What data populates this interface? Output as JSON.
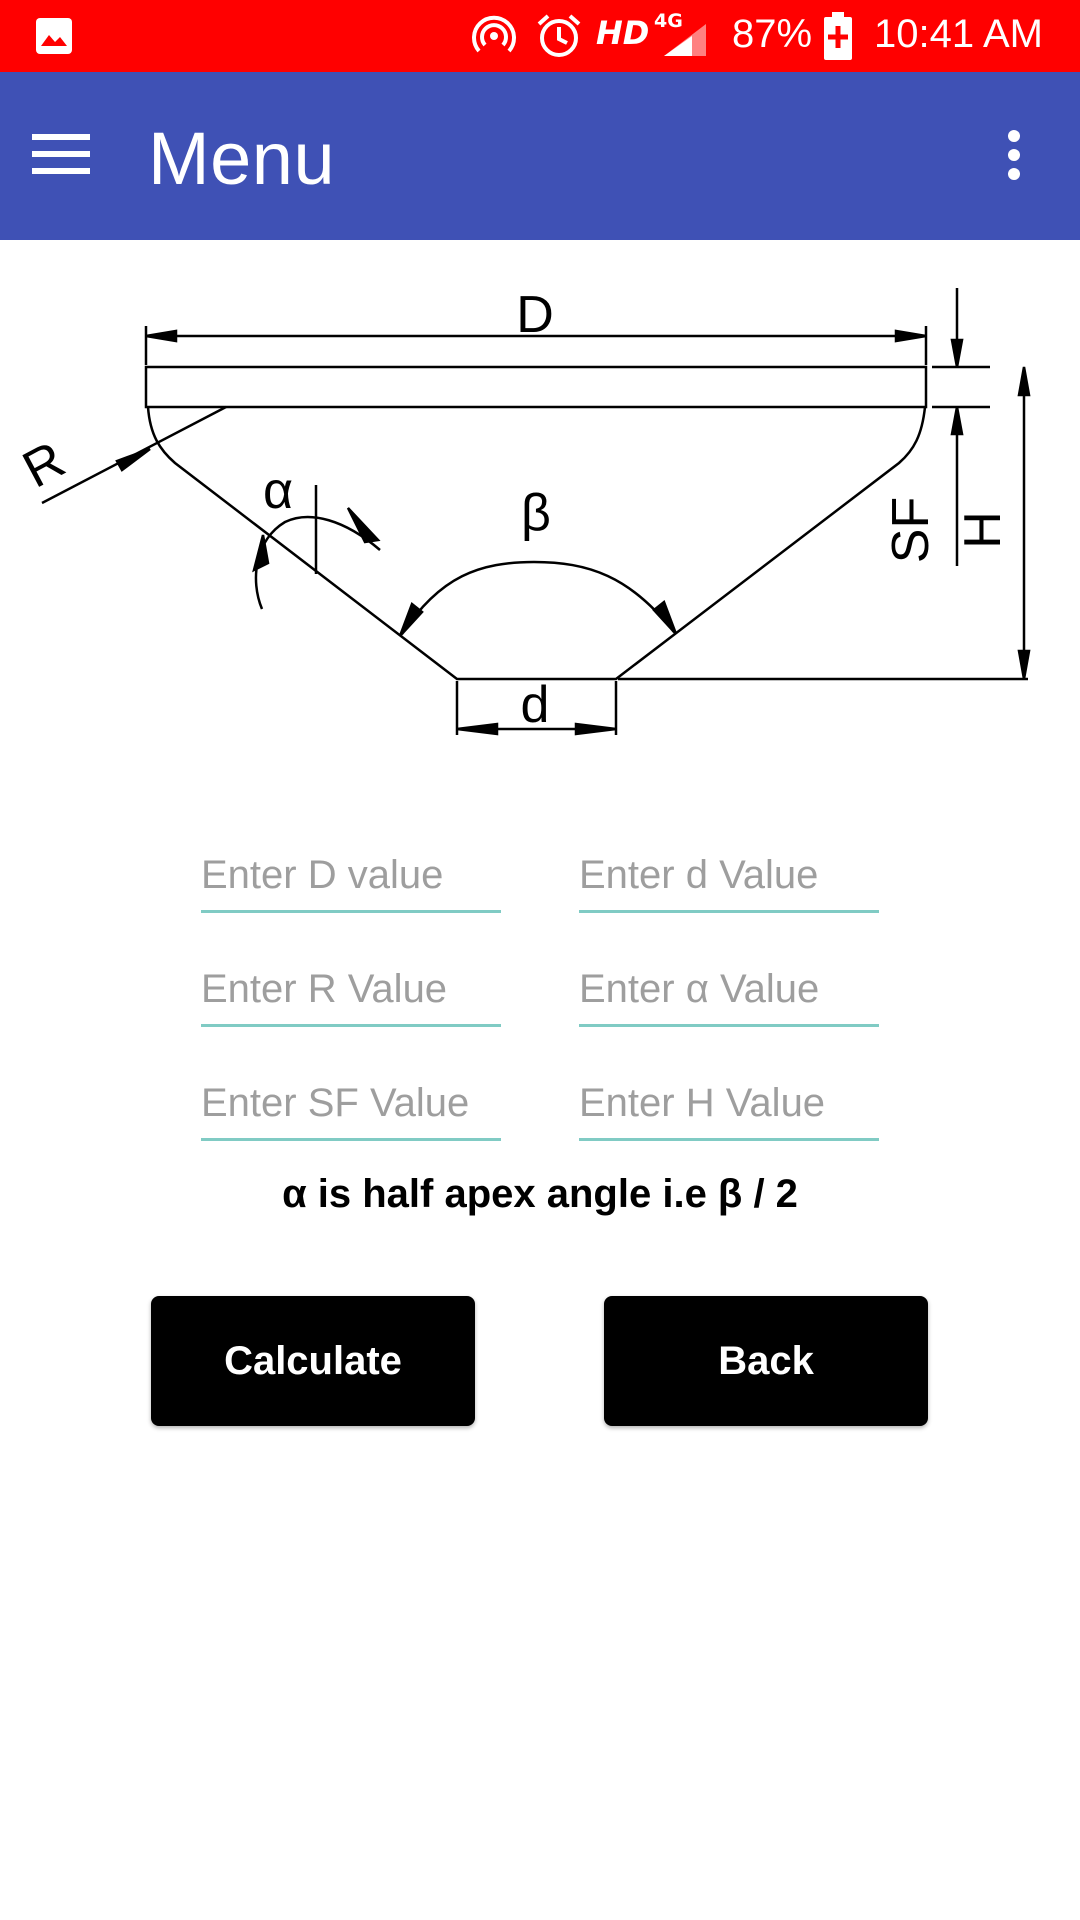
{
  "status_bar": {
    "network": "HD",
    "network_type": "4G",
    "battery": "87%",
    "time": "10:41 AM",
    "icons": [
      "gallery-icon",
      "hotspot-icon",
      "alarm-icon",
      "signal-icon",
      "battery-charging-icon"
    ]
  },
  "app_bar": {
    "title": "Menu",
    "nav_icon": "hamburger-menu-icon",
    "overflow_icon": "more-vert-icon"
  },
  "diagram": {
    "labels": {
      "D": "D",
      "d": "d",
      "R": "R",
      "alpha": "α",
      "beta": "β",
      "SF": "SF",
      "H": "H"
    }
  },
  "fields": {
    "D": {
      "placeholder": "Enter D value",
      "value": ""
    },
    "d": {
      "placeholder": "Enter d Value",
      "value": ""
    },
    "R": {
      "placeholder": "Enter R Value",
      "value": ""
    },
    "alpha": {
      "placeholder": "Enter α Value",
      "value": ""
    },
    "SF": {
      "placeholder": "Enter SF Value",
      "value": ""
    },
    "H": {
      "placeholder": "Enter H Value",
      "value": ""
    }
  },
  "note": "α is half apex angle i.e β / 2",
  "buttons": {
    "calculate": "Calculate",
    "back": "Back"
  },
  "colors": {
    "status_bar": "#ff0000",
    "app_bar": "#3f51b5",
    "field_underline": "#80cbc4",
    "button_bg": "#000000",
    "button_text": "#ffffff"
  }
}
